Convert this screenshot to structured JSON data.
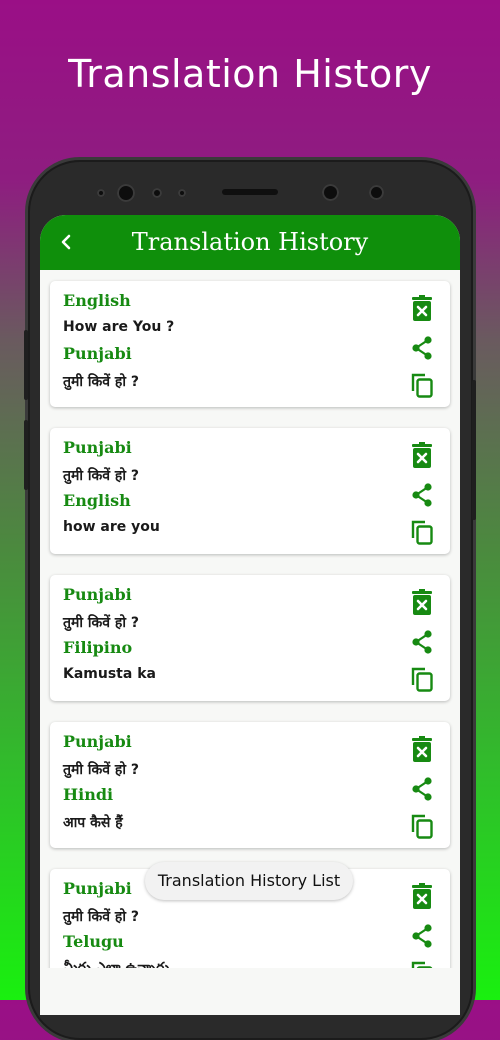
{
  "promo": {
    "title": "Translation History"
  },
  "appbar": {
    "title": "Translation History"
  },
  "cards": [
    {
      "source_lang": "English",
      "source_text": "How are You ?",
      "target_lang": "Punjabi",
      "target_text": "तुमी किवें हो ?"
    },
    {
      "source_lang": "Punjabi",
      "source_text": "तुमी किवें हो ?",
      "target_lang": "English",
      "target_text": "how are you"
    },
    {
      "source_lang": "Punjabi",
      "source_text": "तुमी किवें हो ?",
      "target_lang": "Filipino",
      "target_text": "Kamusta ka"
    },
    {
      "source_lang": "Punjabi",
      "source_text": "तुमी किवें हो ?",
      "target_lang": "Hindi",
      "target_text": "आप कैसे हैं"
    },
    {
      "source_lang": "Punjabi",
      "source_text": "तुमी किवें हो ?",
      "target_lang": "Telugu",
      "target_text": "మీరు ఎలా ఉన్నారు"
    }
  ],
  "toast": {
    "text": "Translation History List"
  },
  "icons": {
    "delete": "delete-icon",
    "share": "share-icon",
    "copy": "copy-icon",
    "back": "back-icon"
  },
  "colors": {
    "accent": "#0f8f0b",
    "label": "#178a12"
  }
}
